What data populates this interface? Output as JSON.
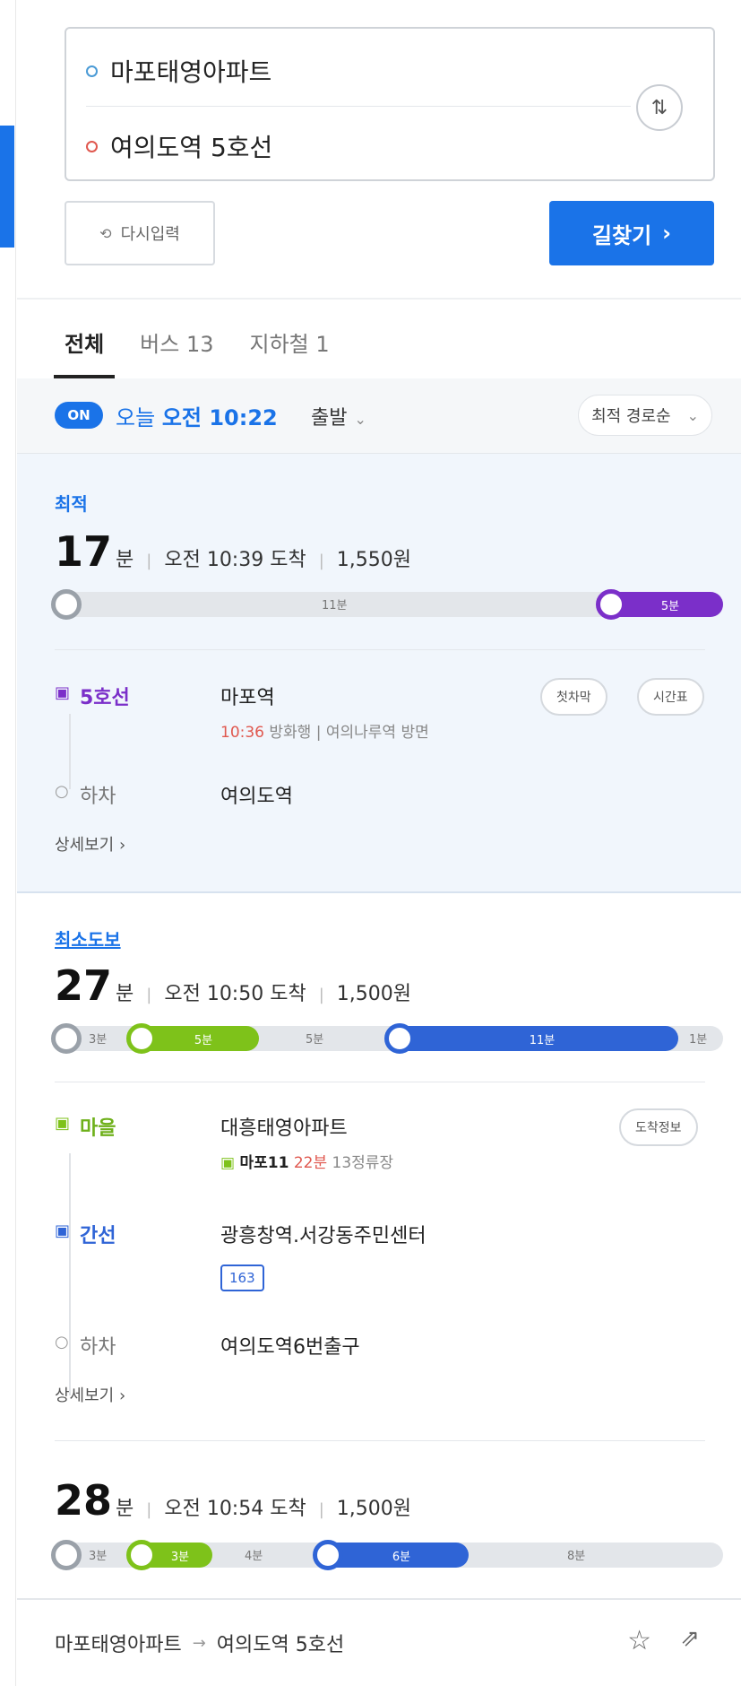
{
  "search": {
    "start": "마포태영아파트",
    "end": "여의도역 5호선",
    "reset_label": "다시입력",
    "find_label": "길찾기",
    "find_chevron": "›",
    "swap_glyph": "⇅"
  },
  "tabs": [
    {
      "label": "전체"
    },
    {
      "label": "버스 13"
    },
    {
      "label": "지하철 1"
    }
  ],
  "time_bar": {
    "on_label": "ON",
    "today": "오늘",
    "time": "오전 10:22",
    "suffix": "출발",
    "sort_label": "최적 경로순"
  },
  "routes": [
    {
      "tag": "최적",
      "minutes": "17",
      "unit": "분",
      "arrival": "오전 10:39 도착",
      "fare": "1,550원",
      "timeline": {
        "walk": "11분",
        "ride": "5분"
      },
      "steps": [
        {
          "type": "5호선",
          "place": "마포역",
          "sub_time": "10:36",
          "sub_text": "방화행 | 여의나루역 방면",
          "btn1": "첫차막",
          "btn2": "시간표"
        },
        {
          "type": "하차",
          "place": "여의도역"
        }
      ],
      "detail": "상세보기 ›"
    },
    {
      "tag": "최소도보",
      "minutes": "27",
      "unit": "분",
      "arrival": "오전 10:50 도착",
      "fare": "1,500원",
      "timeline": {
        "walk1": "3분",
        "green": "5분",
        "walk2": "5분",
        "blue": "11분",
        "walk3": "1분"
      },
      "steps": [
        {
          "type": "마을",
          "place": "대흥태영아파트",
          "bus_name": "마포11",
          "bus_time": "22분",
          "bus_stops": "13정류장",
          "btn": "도착정보"
        },
        {
          "type": "간선",
          "place": "광흥창역.서강동주민센터",
          "bus_num": "163"
        },
        {
          "type": "하차",
          "place": "여의도역6번출구"
        }
      ],
      "detail": "상세보기 ›"
    },
    {
      "minutes": "28",
      "unit": "분",
      "arrival": "오전 10:54 도착",
      "fare": "1,500원",
      "timeline": {
        "walk1": "3분",
        "green": "3분",
        "walk2": "4분",
        "blue": "6분",
        "walk3": "8분"
      }
    }
  ],
  "bottom": {
    "from": "마포태영아파트",
    "arrow": "→",
    "to": "여의도역 5호선"
  },
  "colors": {
    "accent": "#1a73e8",
    "line5": "#7b2fc9",
    "village_bus": "#7ec21a",
    "trunk_bus": "#2f64d6",
    "highlight_bg": "#f1f6fc"
  }
}
